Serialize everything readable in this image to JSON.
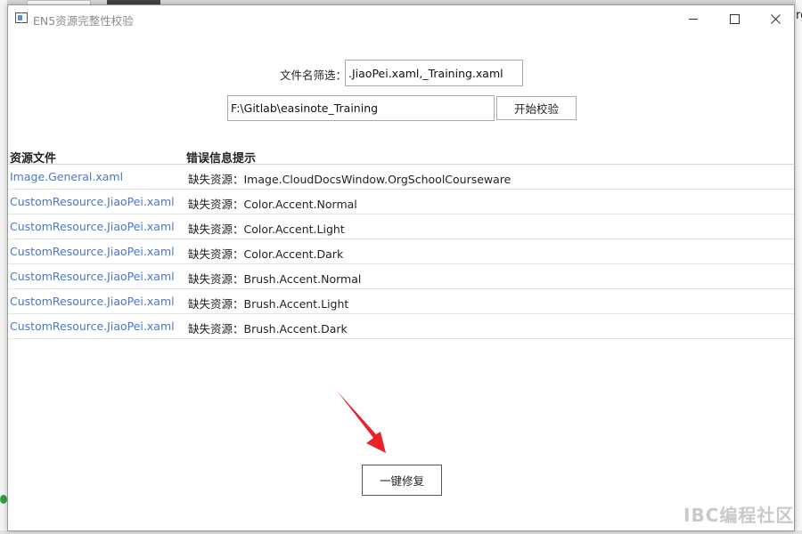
{
  "window": {
    "title": "EN5资源完整性校验"
  },
  "background": {
    "right_edge_text": "rg"
  },
  "form": {
    "filter_label": "文件名筛选：",
    "filter_value": ".JiaoPei.xaml,_Training.xaml",
    "path_value": "F:\\Gitlab\\easinote_Training",
    "start_button": "开始校验"
  },
  "table": {
    "headers": [
      "资源文件",
      "错误信息提示"
    ],
    "rows": [
      {
        "file": "Image.General.xaml",
        "error": "缺失资源：Image.CloudDocsWindow.OrgSchoolCourseware"
      },
      {
        "file": "CustomResource.JiaoPei.xaml",
        "error": "缺失资源：Color.Accent.Normal"
      },
      {
        "file": "CustomResource.JiaoPei.xaml",
        "error": "缺失资源：Color.Accent.Light"
      },
      {
        "file": "CustomResource.JiaoPei.xaml",
        "error": "缺失资源：Color.Accent.Dark"
      },
      {
        "file": "CustomResource.JiaoPei.xaml",
        "error": "缺失资源：Brush.Accent.Normal"
      },
      {
        "file": "CustomResource.JiaoPei.xaml",
        "error": "缺失资源：Brush.Accent.Light"
      },
      {
        "file": "CustomResource.JiaoPei.xaml",
        "error": "缺失资源：Brush.Accent.Dark"
      }
    ]
  },
  "actions": {
    "fix_button": "一键修复"
  },
  "watermark": "IBC编程社区",
  "colors": {
    "link": "#4a78c6",
    "annotation_arrow": "#e8242a"
  },
  "icons": {
    "app": "app-window-icon",
    "minimize": "minimize-icon",
    "maximize": "maximize-icon",
    "close": "close-icon"
  }
}
